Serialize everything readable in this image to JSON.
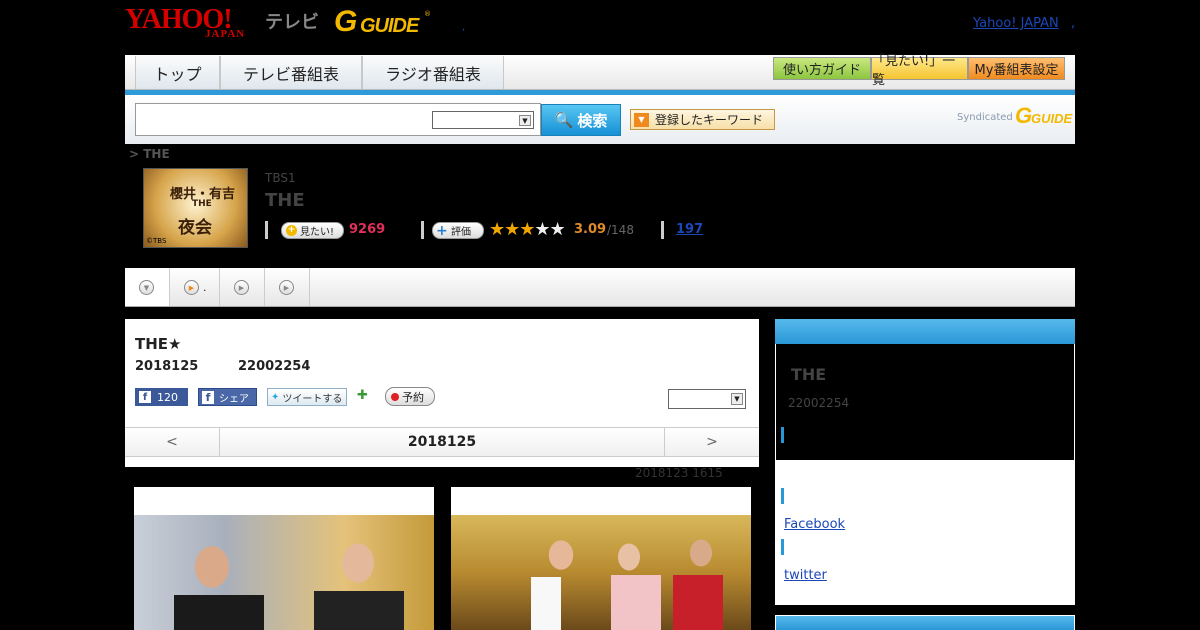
{
  "header": {
    "logo_yahoo": "YAHOO!",
    "logo_japan": "JAPAN",
    "logo_tv": "テレビ",
    "logo_gguide_g": "G",
    "logo_gguide_text": "GUIDE",
    "logo_gguide_reg": "®",
    "yahoo_japan_link": "Yahoo! JAPAN",
    "dot": ",",
    "dot2": ","
  },
  "nav": {
    "tabs": [
      {
        "label": "トップ"
      },
      {
        "label": "テレビ番組表"
      },
      {
        "label": "ラジオ番組表"
      }
    ],
    "buttons": {
      "guide": "使い方ガイド",
      "mitai_list": "「見たい!」一覧",
      "my_schedule": "My番組表設定"
    },
    "accent_color": "#2f9ad8"
  },
  "search": {
    "placeholder": "",
    "select_value": "",
    "button_label": "検索",
    "keyword_button": "登録したキーワード",
    "syndicated_text": "Syndicated",
    "syndicated_g": "G",
    "syndicated_guide": "GUIDE"
  },
  "breadcrumb": "> THE",
  "program": {
    "thumb_text1": "櫻井・有吉",
    "thumb_text2": "THE",
    "thumb_text3": "夜会",
    "thumb_copy": "©TBS",
    "station": "TBS1",
    "title": "THE",
    "mitai_label": "見たい!",
    "mitai_count": "9269",
    "rating_label": "評価",
    "stars_on": "★★★",
    "stars_off": "★★",
    "rating_score": "3.09",
    "rating_count": "/148",
    "review_count": "197"
  },
  "tabs": [
    {
      "label": ""
    },
    {
      "label": "."
    },
    {
      "label": ""
    },
    {
      "label": ""
    }
  ],
  "episode": {
    "title": "THE★",
    "date": "2018125",
    "time": "22002254",
    "like_count": "120",
    "share_label": "シェア",
    "tweet_label": "ツイートする",
    "reserve_label": "予約",
    "select_value": "",
    "prev": "<",
    "current_date": "2018125",
    "next": ">",
    "updated": "2018123  1615"
  },
  "side": {
    "title": "THE",
    "time": "22002254",
    "facebook": "Facebook",
    "twitter": "twitter"
  }
}
